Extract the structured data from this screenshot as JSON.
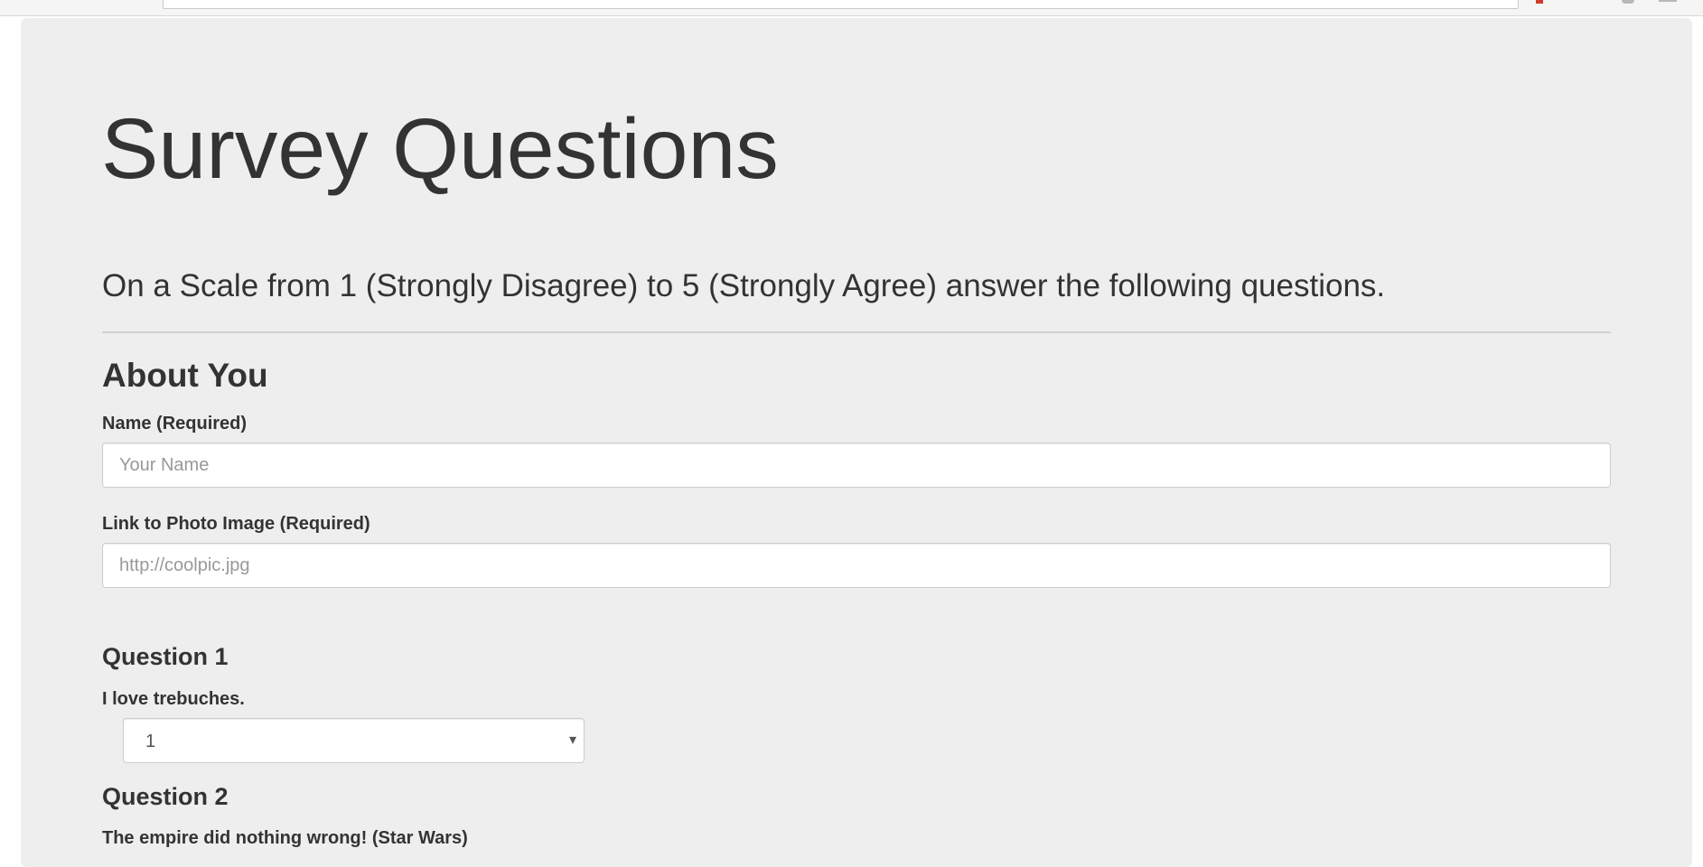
{
  "page": {
    "title": "Survey Questions",
    "lead": "On a Scale from 1 (Strongly Disagree) to 5 (Strongly Agree) answer the following questions."
  },
  "about": {
    "heading": "About You",
    "name_label": "Name (Required)",
    "name_placeholder": "Your Name",
    "photo_label": "Link to Photo Image (Required)",
    "photo_placeholder": "http://coolpic.jpg"
  },
  "questions": [
    {
      "heading": "Question 1",
      "text": "I love trebuches.",
      "selected": "1",
      "caret": "▾"
    },
    {
      "heading": "Question 2",
      "text": "The empire did nothing wrong! (Star Wars)"
    }
  ]
}
